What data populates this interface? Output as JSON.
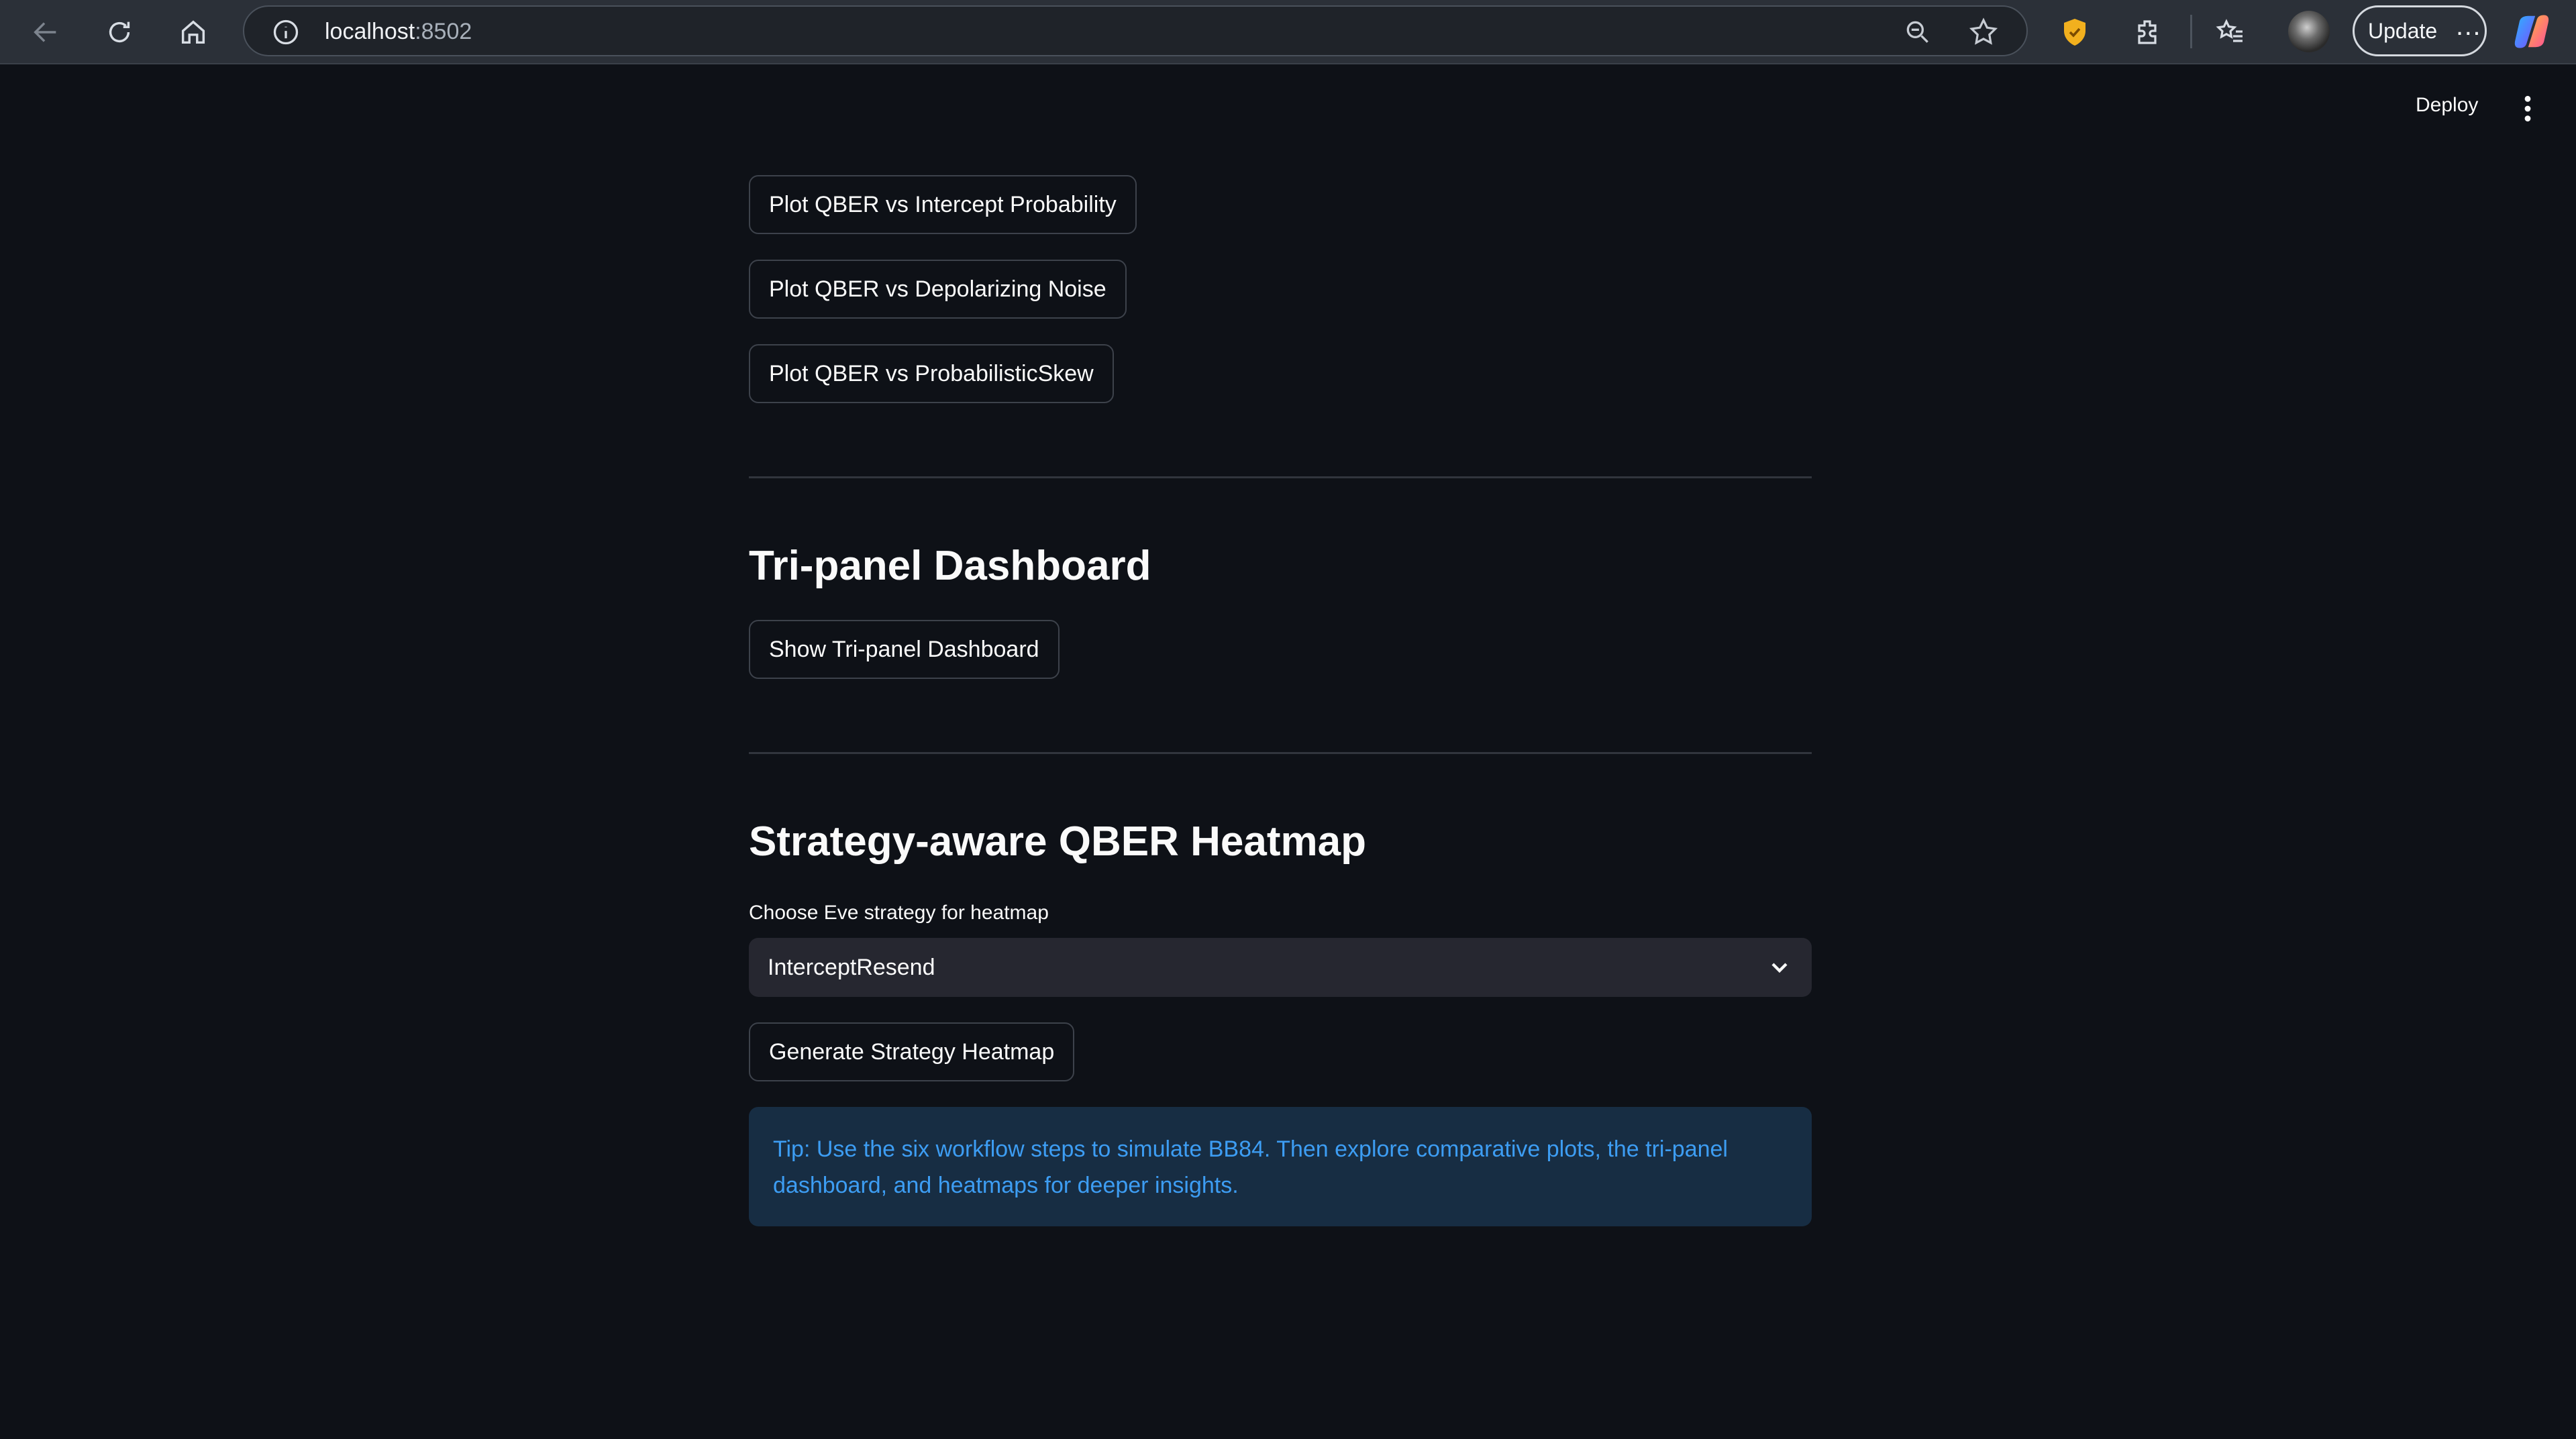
{
  "browser": {
    "url_host": "localhost",
    "url_port": ":8502",
    "update_label": "Update"
  },
  "header": {
    "deploy_label": "Deploy"
  },
  "plots": {
    "buttons": [
      "Plot QBER vs Intercept Probability",
      "Plot QBER vs Depolarizing Noise",
      "Plot QBER vs ProbabilisticSkew"
    ]
  },
  "tripanel": {
    "title": "Tri-panel Dashboard",
    "button_label": "Show Tri-panel Dashboard"
  },
  "heatmap": {
    "title": "Strategy-aware QBER Heatmap",
    "select_label": "Choose Eve strategy for heatmap",
    "selected_value": "InterceptResend",
    "button_label": "Generate Strategy Heatmap"
  },
  "tip": {
    "text": "Tip: Use the six workflow steps to simulate BB84. Then explore comparative plots, the tri-panel dashboard, and heatmaps for deeper insights."
  },
  "colors": {
    "background": "#0e1117",
    "tip_background": "#172d43",
    "tip_text": "#3d9df3",
    "select_background": "#262730"
  }
}
